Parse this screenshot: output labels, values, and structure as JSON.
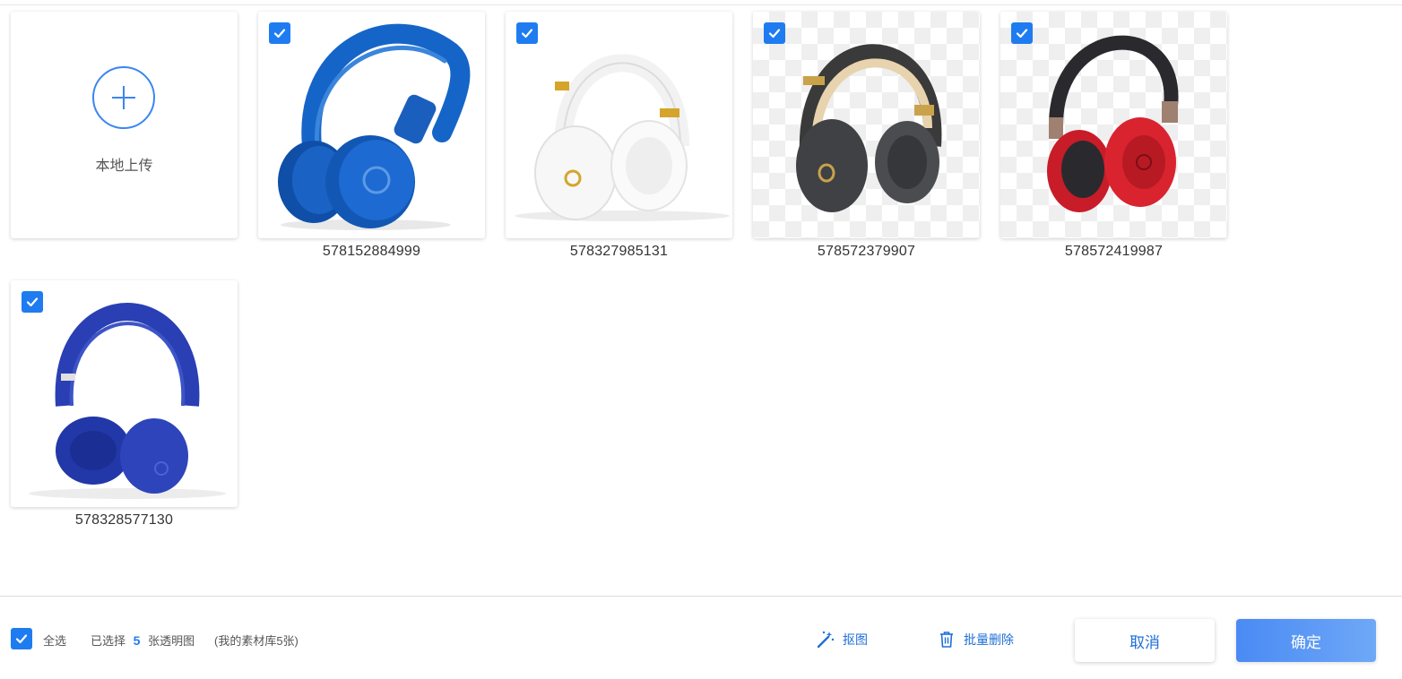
{
  "upload": {
    "label": "本地上传",
    "icon": "plus-circle-icon"
  },
  "images": [
    {
      "id": "578152884999",
      "checked": true,
      "color": "#1565c8"
    },
    {
      "id": "578327985131",
      "checked": true,
      "color": "#f4f4f4"
    },
    {
      "id": "578572379907",
      "checked": true,
      "color": "#3c3c3c"
    },
    {
      "id": "578572419987",
      "checked": true,
      "color": "#d0202a"
    },
    {
      "id": "578328577130",
      "checked": true,
      "color": "#2a3fb4"
    }
  ],
  "footer": {
    "select_all_label": "全选",
    "selected_prefix": "已选择",
    "selected_count": "5",
    "selected_suffix": "张透明图",
    "library_note": "(我的素材库5张)",
    "cutout_label": "抠图",
    "batch_delete_label": "批量删除",
    "cancel_label": "取消",
    "confirm_label": "确定"
  },
  "colors": {
    "accent": "#1f7cf0",
    "link": "#1f6fd6"
  }
}
